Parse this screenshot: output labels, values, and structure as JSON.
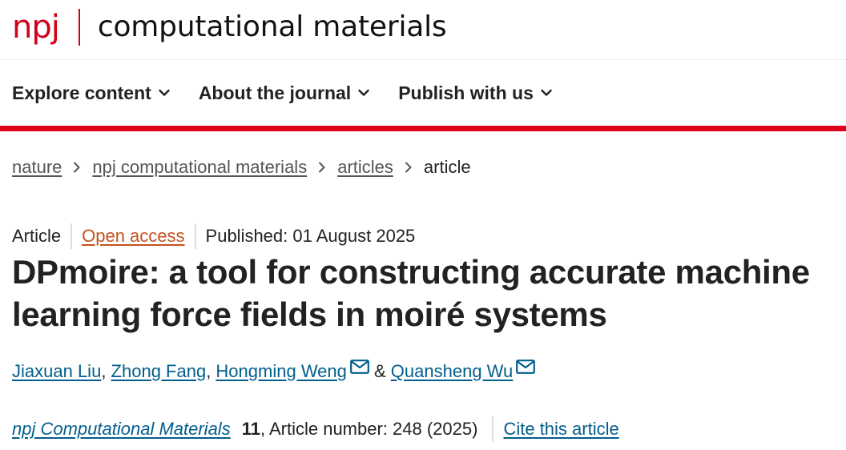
{
  "logo": {
    "brand": "npj",
    "journal_title": "computational materials"
  },
  "nav": {
    "items": [
      {
        "label": "Explore content",
        "icon": "chevron-down-icon"
      },
      {
        "label": "About the journal",
        "icon": "chevron-down-icon"
      },
      {
        "label": "Publish with us",
        "icon": "chevron-down-icon"
      }
    ]
  },
  "breadcrumb": {
    "items": [
      {
        "label": "nature"
      },
      {
        "label": "npj computational materials"
      },
      {
        "label": "articles"
      }
    ],
    "current": "article"
  },
  "article": {
    "type": "Article",
    "access": "Open access",
    "published": "Published: 01 August 2025",
    "title_line1": "DPmoire: a tool for constructing accurate machine",
    "title_line2": "learning force fields in moiré systems",
    "authors": [
      {
        "name": "Jiaxuan Liu",
        "after": ", "
      },
      {
        "name": "Zhong Fang",
        "after": ", "
      },
      {
        "name": "Hongming Weng",
        "after": " & ",
        "email_icon": true
      },
      {
        "name": "Quansheng Wu",
        "after": "",
        "email_icon": true
      }
    ],
    "journal": "npj Computational Materials",
    "volume": "11",
    "article_number": ", Article number: 248 (2025)",
    "cite_label": "Cite this article"
  },
  "colors": {
    "brand_red": "#e0001b",
    "link_blue": "#025e8d",
    "open_access_orange": "#c4521d"
  }
}
